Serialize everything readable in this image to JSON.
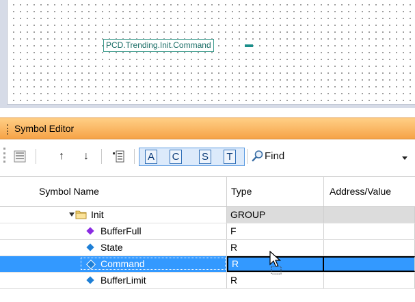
{
  "canvas": {
    "symbol_label": "PCD.Trending.Init.Command"
  },
  "panel": {
    "title": "Symbol Editor"
  },
  "toolbar": {
    "list_icon": "list-view-icon",
    "up_label": "↑",
    "down_label": "↓",
    "properties_icon": "properties-icon",
    "letters": [
      "A",
      "C",
      "S",
      "T"
    ],
    "find_label": "Find",
    "find_value": ""
  },
  "grid": {
    "columns": [
      "Symbol Name",
      "Type",
      "Address/Value"
    ],
    "rows": [
      {
        "name": "Init",
        "type": "GROUP",
        "address": "",
        "kind": "group"
      },
      {
        "name": "BufferFull",
        "type": "F",
        "address": "",
        "kind": "flag",
        "icon_color": "#8a2be2"
      },
      {
        "name": "State",
        "type": "R",
        "address": "",
        "kind": "register",
        "icon_color": "#1e7fd6"
      },
      {
        "name": "Command",
        "type": "R",
        "address": "",
        "kind": "register",
        "icon_color": "#1e7fd6",
        "selected": true
      },
      {
        "name": "BufferLimit",
        "type": "R",
        "address": "",
        "kind": "register",
        "icon_color": "#1e7fd6"
      }
    ]
  },
  "colors": {
    "header_orange": "#f6a347",
    "selection_blue": "#3399ff",
    "group_gray": "#dcdcdc"
  }
}
